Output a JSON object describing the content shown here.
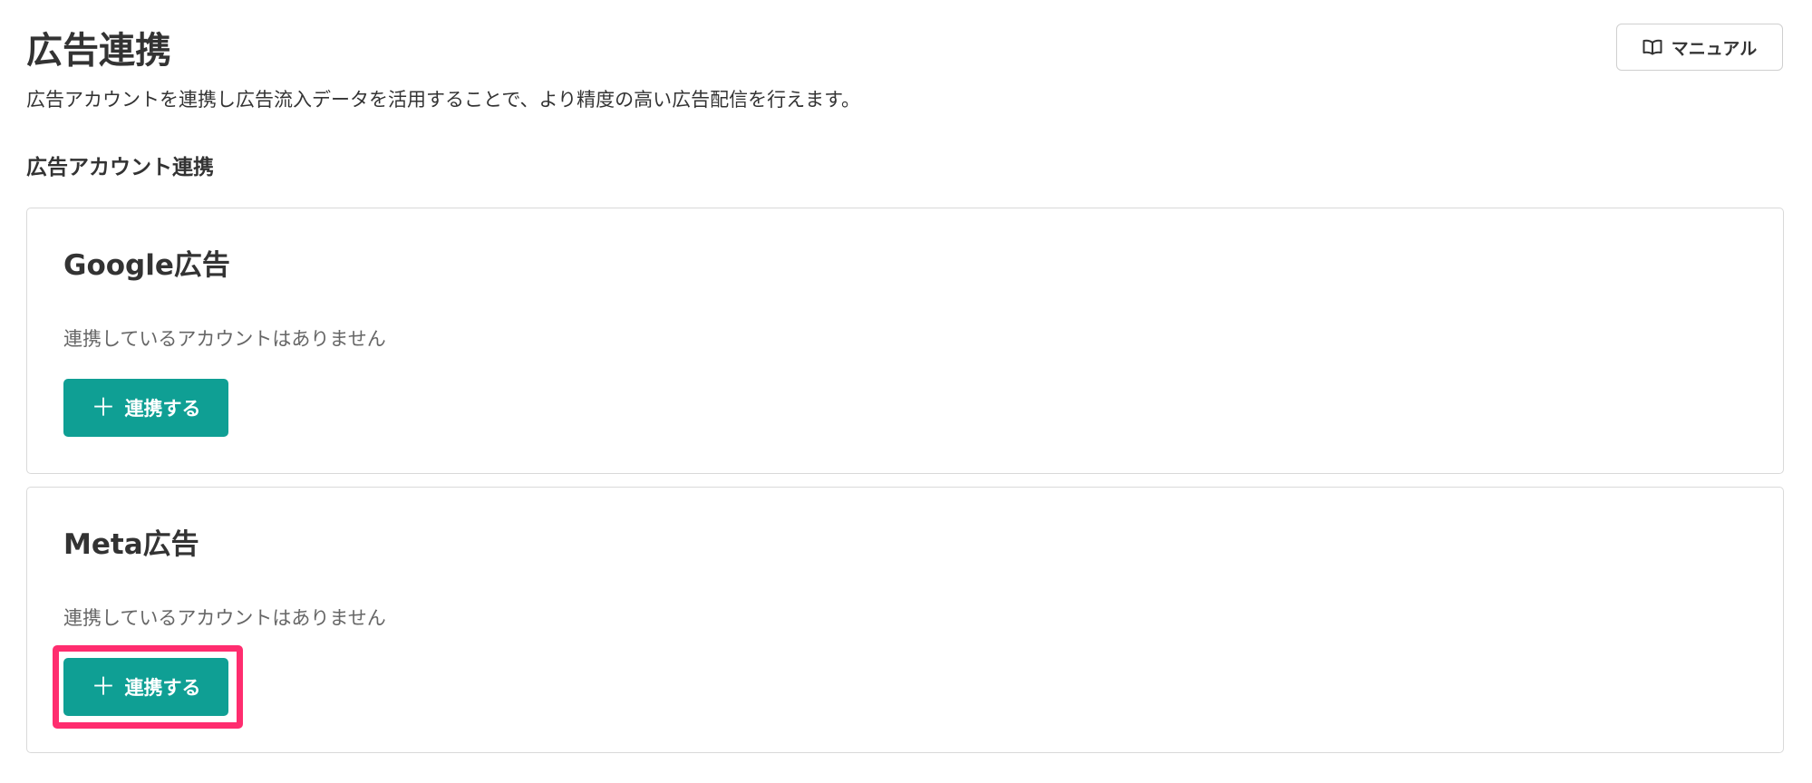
{
  "header": {
    "title": "広告連携",
    "description": "広告アカウントを連携し広告流入データを活用することで、より精度の高い広告配信を行えます。",
    "manual_button": {
      "label": "マニュアル",
      "icon": "book-icon"
    }
  },
  "section": {
    "title": "広告アカウント連携"
  },
  "cards": [
    {
      "title": "Google広告",
      "empty_message": "連携しているアカウントはありません",
      "button_label": "連携する",
      "button_icon": "plus-icon"
    },
    {
      "title": "Meta広告",
      "empty_message": "連携しているアカウントはありません",
      "button_label": "連携する",
      "button_icon": "plus-icon",
      "highlighted": true
    }
  ],
  "colors": {
    "primary_button": "#0f9f94",
    "highlight_frame": "#ff2d6f",
    "text": "#333333",
    "muted_text": "#666666",
    "border": "#d9d9d9"
  }
}
